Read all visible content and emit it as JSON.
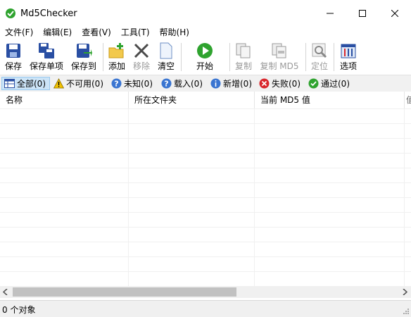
{
  "window": {
    "title": "Md5Checker"
  },
  "menu": [
    "文件(F)",
    "编辑(E)",
    "查看(V)",
    "工具(T)",
    "帮助(H)"
  ],
  "toolbar": {
    "save": "保存",
    "save_single": "保存单项",
    "save_to": "保存到",
    "add": "添加",
    "remove": "移除",
    "clear": "清空",
    "start": "开始",
    "copy": "复制",
    "copy_md5": "复制 MD5",
    "locate": "定位",
    "options": "选项"
  },
  "filters": {
    "all": "全部(0)",
    "unavailable": "不可用(0)",
    "unknown": "未知(0)",
    "loaded": "载入(0)",
    "new": "新增(0)",
    "failed": "失败(0)",
    "passed": "通过(0)"
  },
  "columns": {
    "name": "名称",
    "folder": "所在文件夹",
    "current_md5": "当前 MD5 值",
    "partial": "值"
  },
  "status": {
    "text": "0 个对象"
  },
  "colors": {
    "accent": "#0078d7",
    "success": "#2fa32f",
    "error": "#d9262c",
    "warning": "#f2c200"
  }
}
